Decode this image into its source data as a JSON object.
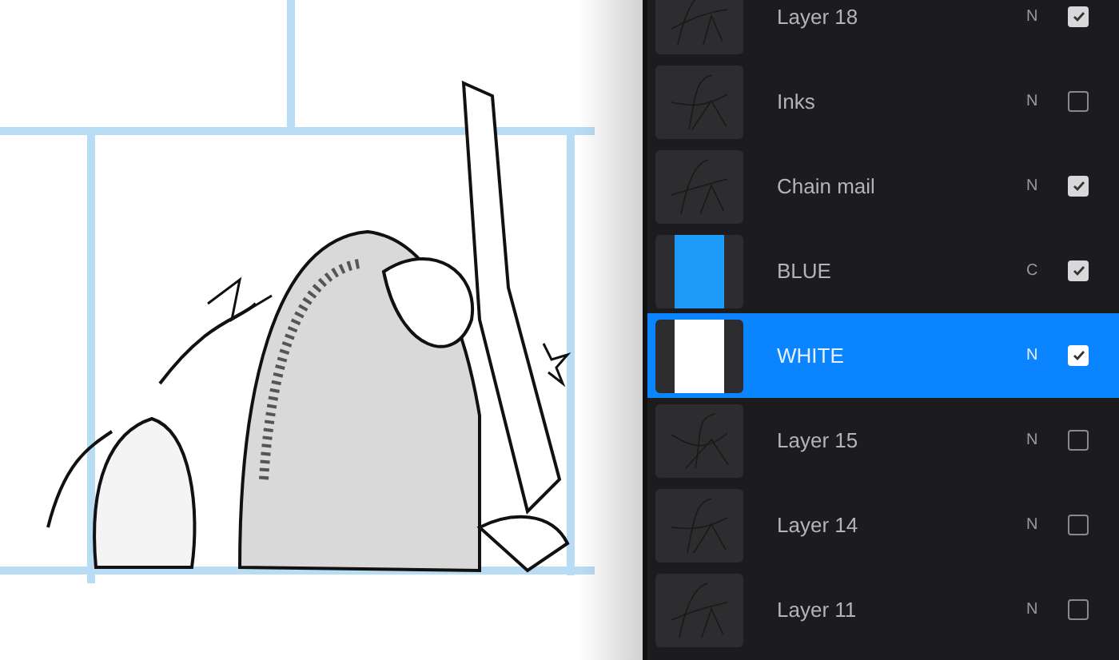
{
  "layers": [
    {
      "name": "Layer 18",
      "blend": "N",
      "visible": true,
      "selected": false,
      "kind": "sketch"
    },
    {
      "name": "Inks",
      "blend": "N",
      "visible": false,
      "selected": false,
      "kind": "sketch"
    },
    {
      "name": "Chain mail",
      "blend": "N",
      "visible": true,
      "selected": false,
      "kind": "sketch"
    },
    {
      "name": "BLUE",
      "blend": "C",
      "visible": true,
      "selected": false,
      "kind": "blue"
    },
    {
      "name": "WHITE",
      "blend": "N",
      "visible": true,
      "selected": true,
      "kind": "white"
    },
    {
      "name": "Layer 15",
      "blend": "N",
      "visible": false,
      "selected": false,
      "kind": "sketch"
    },
    {
      "name": "Layer 14",
      "blend": "N",
      "visible": false,
      "selected": false,
      "kind": "sketch"
    },
    {
      "name": "Layer 11",
      "blend": "N",
      "visible": false,
      "selected": false,
      "kind": "sketch"
    }
  ]
}
